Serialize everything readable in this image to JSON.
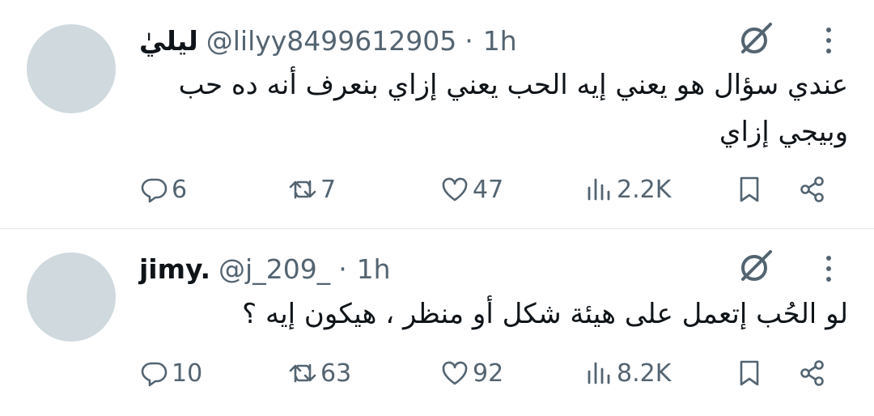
{
  "tweets": [
    {
      "author": "ليليٰ",
      "handle": "@lilyy8499612905",
      "separator": "·",
      "time": "1h",
      "text": "عندي سؤال هو يعني إيه الحب يعني إزاي بنعرف أنه ده حب وبيجي إزاي",
      "stats": {
        "replies": "6",
        "reposts": "7",
        "likes": "47",
        "views": "2.2K"
      }
    },
    {
      "author": "jimy.",
      "handle": "@j_209_",
      "separator": "·",
      "time": "1h",
      "text": "لو الحُب إتعمل على هيئة شكل أو منظر ، هيكون إيه ؟",
      "stats": {
        "replies": "10",
        "reposts": "63",
        "likes": "92",
        "views": "8.2K"
      }
    }
  ],
  "colors": {
    "text": "#0f1419",
    "muted": "#536471",
    "avatar": "#cfd9de",
    "divider": "#e6e9ec"
  },
  "icons": [
    "grok-icon",
    "more-icon",
    "reply-icon",
    "repost-icon",
    "like-icon",
    "views-icon",
    "bookmark-icon",
    "share-icon"
  ]
}
